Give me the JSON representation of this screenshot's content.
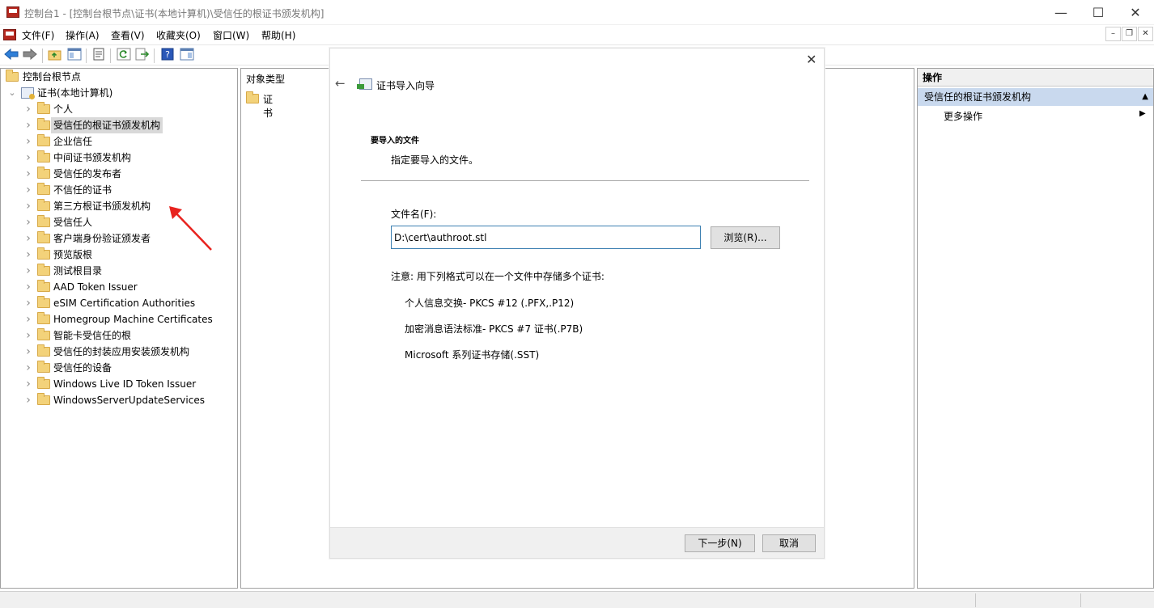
{
  "window": {
    "title": "控制台1 - [控制台根节点\\证书(本地计算机)\\受信任的根证书颁发机构]",
    "min": "—",
    "max": "☐",
    "close": "✕"
  },
  "menu": [
    "文件(F)",
    "操作(A)",
    "查看(V)",
    "收藏夹(O)",
    "窗口(W)",
    "帮助(H)"
  ],
  "mdi_controls": [
    "–",
    "❐",
    "✕"
  ],
  "tree": {
    "root": "控制台根节点",
    "computer": "证书(本地计算机)",
    "items": [
      "个人",
      "受信任的根证书颁发机构",
      "企业信任",
      "中间证书颁发机构",
      "受信任的发布者",
      "不信任的证书",
      "第三方根证书颁发机构",
      "受信任人",
      "客户端身份验证颁发者",
      "预览版根",
      "测试根目录",
      "AAD Token Issuer",
      "eSIM Certification Authorities",
      "Homegroup Machine Certificates",
      "智能卡受信任的根",
      "受信任的封装应用安装颁发机构",
      "受信任的设备",
      "Windows Live ID Token Issuer",
      "WindowsServerUpdateServices"
    ],
    "selected_index": 1
  },
  "middle": {
    "column_header": "对象类型",
    "item": "证书"
  },
  "actions": {
    "header": "操作",
    "group": "受信任的根证书颁发机构",
    "more": "更多操作"
  },
  "wizard": {
    "title": "证书导入向导",
    "section_title": "要导入的文件",
    "subtitle": "指定要导入的文件。",
    "filename_label": "文件名(F):",
    "filename_value": "D:\\cert\\authroot.stl",
    "browse": "浏览(R)...",
    "note": "注意: 用下列格式可以在一个文件中存储多个证书:",
    "formats": [
      "个人信息交换- PKCS #12 (.PFX,.P12)",
      "加密消息语法标准- PKCS #7 证书(.P7B)",
      "Microsoft 系列证书存储(.SST)"
    ],
    "next": "下一步(N)",
    "cancel": "取消"
  },
  "colors": {
    "selection_bg": "#d9d9d9",
    "actions_group_bg": "#c9d9ee",
    "annotation_arrow": "#e8231f",
    "input_border": "#3c7fb1"
  }
}
